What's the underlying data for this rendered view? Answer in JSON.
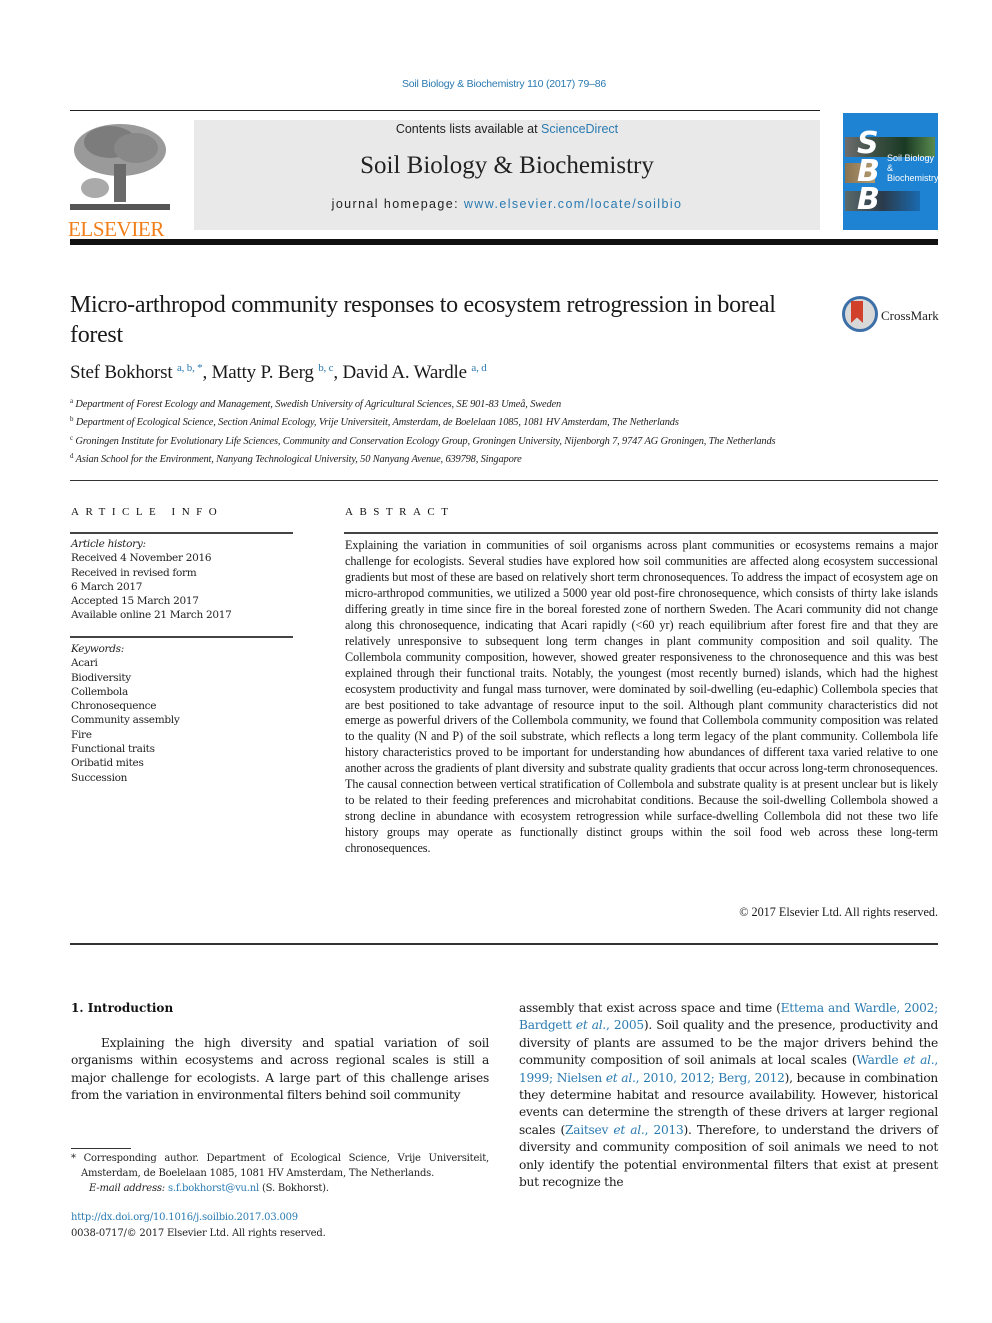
{
  "header": {
    "citation": "Soil Biology & Biochemistry 110 (2017) 79–86",
    "publisher_logo_text": "ELSEVIER",
    "contents_prefix": "Contents lists available at ",
    "contents_link": "ScienceDirect",
    "journal_title": "Soil Biology & Biochemistry",
    "homepage_prefix": "journal homepage: ",
    "homepage_link": "www.elsevier.com/locate/soilbio",
    "cover": {
      "letters": [
        "S",
        "B",
        "B"
      ],
      "title_line1": "Soil Biology &",
      "title_line2": "Biochemistry",
      "color": "#1e83d2"
    },
    "crossmark_label": "CrossMark"
  },
  "article": {
    "title": "Micro-arthropod community responses to ecosystem retrogression in boreal forest",
    "authors": [
      {
        "name": "Stef Bokhorst",
        "sup": "a, b, *"
      },
      {
        "name": "Matty P. Berg",
        "sup": "b, c"
      },
      {
        "name": "David A. Wardle",
        "sup": "a, d"
      }
    ],
    "affiliations": [
      {
        "key": "a",
        "text": "Department of Forest Ecology and Management, Swedish University of Agricultural Sciences, SE 901-83 Umeå, Sweden"
      },
      {
        "key": "b",
        "text": "Department of Ecological Science, Section Animal Ecology, Vrije Universiteit, Amsterdam, de Boelelaan 1085, 1081 HV Amsterdam, The Netherlands"
      },
      {
        "key": "c",
        "text": "Groningen Institute for Evolutionary Life Sciences, Community and Conservation Ecology Group, Groningen University, Nijenborgh 7, 9747 AG Groningen, The Netherlands"
      },
      {
        "key": "d",
        "text": "Asian School for the Environment, Nanyang Technological University, 50 Nanyang Avenue, 639798, Singapore"
      }
    ]
  },
  "article_info": {
    "heading": "ARTICLE INFO",
    "history_label": "Article history:",
    "history": [
      "Received 4 November 2016",
      "Received in revised form",
      "6 March 2017",
      "Accepted 15 March 2017",
      "Available online 21 March 2017"
    ],
    "keywords_label": "Keywords:",
    "keywords": [
      "Acari",
      "Biodiversity",
      "Collembola",
      "Chronosequence",
      "Community assembly",
      "Fire",
      "Functional traits",
      "Oribatid mites",
      "Succession"
    ]
  },
  "abstract": {
    "heading": "ABSTRACT",
    "text": "Explaining the variation in communities of soil organisms across plant communities or ecosystems remains a major challenge for ecologists. Several studies have explored how soil communities are affected along ecosystem successional gradients but most of these are based on relatively short term chronosequences. To address the impact of ecosystem age on micro-arthropod communities, we utilized a 5000 year old post-fire chronosequence, which consists of thirty lake islands differing greatly in time since fire in the boreal forested zone of northern Sweden. The Acari community did not change along this chronosequence, indicating that Acari rapidly (<60 yr) reach equilibrium after forest fire and that they are relatively unresponsive to subsequent long term changes in plant community composition and soil quality. The Collembola community composition, however, showed greater responsiveness to the chronosequence and this was best explained through their functional traits. Notably, the youngest (most recently burned) islands, which had the highest ecosystem productivity and fungal mass turnover, were dominated by soil-dwelling (eu-edaphic) Collembola species that are best positioned to take advantage of resource input to the soil. Although plant community characteristics did not emerge as powerful drivers of the Collembola community, we found that Collembola community composition was related to the quality (N and P) of the soil substrate, which reflects a long term legacy of the plant community. Collembola life history characteristics proved to be important for understanding how abundances of different taxa varied relative to one another across the gradients of plant diversity and substrate quality gradients that occur across long-term chronosequences. The causal connection between vertical stratification of Collembola and substrate quality is at present unclear but is likely to be related to their feeding preferences and microhabitat conditions. Because the soil-dwelling Collembola showed a strong decline in abundance with ecosystem retrogression while surface-dwelling Collembola did not these two life history groups may operate as functionally distinct groups within the soil food web across these long-term chronosequences.",
    "copyright": "© 2017 Elsevier Ltd. All rights reserved."
  },
  "body": {
    "section_heading": "1.  Introduction",
    "left_paragraph": "Explaining the high diversity and spatial variation of soil organisms within ecosystems and across regional scales is still a major challenge for ecologists. A large part of this challenge arises from the variation in environmental filters behind soil community",
    "right_segments": [
      {
        "t": "assembly that exist across space and time (",
        "link": false
      },
      {
        "t": "Ettema and Wardle, 2002; Bardgett ",
        "link": true
      },
      {
        "t": "et al.",
        "link": true,
        "italic": true
      },
      {
        "t": ", 2005",
        "link": true
      },
      {
        "t": "). Soil quality and the presence, productivity and diversity of plants are assumed to be the major drivers behind the community composition of soil animals at local scales (",
        "link": false
      },
      {
        "t": "Wardle ",
        "link": true
      },
      {
        "t": "et al.",
        "link": true,
        "italic": true
      },
      {
        "t": ", 1999; Nielsen ",
        "link": true
      },
      {
        "t": "et al.",
        "link": true,
        "italic": true
      },
      {
        "t": ", 2010, 2012; Berg, 2012",
        "link": true
      },
      {
        "t": "), because in combination they determine habitat and resource availability. However, historical events can determine the strength of these drivers at larger regional scales (",
        "link": false
      },
      {
        "t": "Zaitsev ",
        "link": true
      },
      {
        "t": "et al.",
        "link": true,
        "italic": true
      },
      {
        "t": ", 2013",
        "link": true
      },
      {
        "t": "). Therefore, to understand the drivers of diversity and community composition of soil animals we need to not only identify the potential environmental filters that exist at present but recognize the",
        "link": false
      }
    ]
  },
  "footnote": {
    "corresponding": "* Corresponding author. Department of Ecological Science, Vrije Universiteit, Amsterdam, de Boelelaan 1085, 1081 HV Amsterdam, The Netherlands.",
    "email_label": "E-mail address: ",
    "email": "s.f.bokhorst@vu.nl",
    "email_suffix": " (S. Bokhorst).",
    "doi": "http://dx.doi.org/10.1016/j.soilbio.2017.03.009",
    "issn_copyright": "0038-0717/© 2017 Elsevier Ltd. All rights reserved."
  }
}
